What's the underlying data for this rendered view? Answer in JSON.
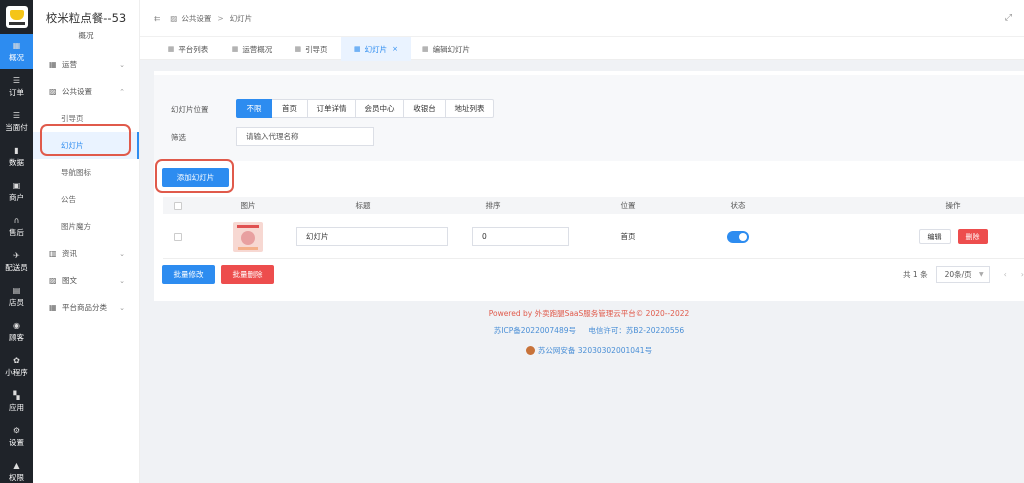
{
  "nav": {
    "items": [
      {
        "label": "概况",
        "icon": "dashboard-icon",
        "glyph": "▦",
        "active": true
      },
      {
        "label": "订单",
        "icon": "list-icon",
        "glyph": "☰"
      },
      {
        "label": "当面付",
        "icon": "pay-icon",
        "glyph": "☰"
      },
      {
        "label": "数据",
        "icon": "chart-icon",
        "glyph": "▮"
      },
      {
        "label": "商户",
        "icon": "store-icon",
        "glyph": "▣"
      },
      {
        "label": "售后",
        "icon": "headset-icon",
        "glyph": "∩"
      },
      {
        "label": "配送员",
        "icon": "rider-icon",
        "glyph": "✈"
      },
      {
        "label": "店员",
        "icon": "staff-icon",
        "glyph": "▤"
      },
      {
        "label": "顾客",
        "icon": "customer-icon",
        "glyph": "◉"
      },
      {
        "label": "小程序",
        "icon": "mini-program-icon",
        "glyph": "✿"
      },
      {
        "label": "应用",
        "icon": "apps-icon",
        "glyph": "▚"
      },
      {
        "label": "设置",
        "icon": "settings-icon",
        "glyph": "⚙"
      },
      {
        "label": "权限",
        "icon": "lock-icon",
        "glyph": "▲"
      }
    ]
  },
  "sidebar": {
    "store_name": "校米粒点餐--53",
    "store_sub": "概况",
    "menu": [
      {
        "label": "运营",
        "icon": "operation-icon",
        "glyph": "▦",
        "chevron": "⌄"
      },
      {
        "label": "公共设置",
        "icon": "image-icon",
        "glyph": "▨",
        "chevron": "⌃"
      }
    ],
    "sub_items": [
      {
        "label": "引导页"
      },
      {
        "label": "幻灯片",
        "active": true
      },
      {
        "label": "导航图标"
      },
      {
        "label": "公告"
      },
      {
        "label": "图片魔方"
      }
    ],
    "menu_after": [
      {
        "label": "资讯",
        "icon": "news-icon",
        "glyph": "▥",
        "chevron": "⌄"
      },
      {
        "label": "图文",
        "icon": "article-icon",
        "glyph": "▨",
        "chevron": "⌄"
      },
      {
        "label": "平台商品分类",
        "icon": "category-icon",
        "glyph": "▦",
        "chevron": "⌄"
      }
    ]
  },
  "topbar": {
    "collapse_glyph": "⇇",
    "crumb_glyph": "▨",
    "crumb_1": "公共设置",
    "crumb_sep": ">",
    "crumb_2": "幻灯片",
    "fullscreen_glyph": "⤢"
  },
  "tabs": [
    {
      "label": "平台列表"
    },
    {
      "label": "运营概况"
    },
    {
      "label": "引导页"
    },
    {
      "label": "幻灯片",
      "active": true,
      "close": "×"
    },
    {
      "label": "编辑幻灯片"
    }
  ],
  "filter": {
    "position_label": "幻灯片位置",
    "positions": [
      "不限",
      "首页",
      "订单详情",
      "会员中心",
      "收银台",
      "地址列表"
    ],
    "active_position": 0,
    "screen_label": "筛选",
    "search_placeholder": "请输入代理名称"
  },
  "actions": {
    "add": "添加幻灯片",
    "batch_edit": "批量修改",
    "batch_delete": "批量删除"
  },
  "table": {
    "columns": [
      "图片",
      "标题",
      "排序",
      "位置",
      "状态",
      "操作"
    ],
    "rows": [
      {
        "title": "幻灯片",
        "sort": "0",
        "position": "首页",
        "enabled": true,
        "edit": "编辑",
        "delete": "删除"
      }
    ]
  },
  "pager": {
    "total": "共 1 条",
    "page_size": "20条/页",
    "prev": "‹",
    "next": "›"
  },
  "footer": {
    "powered": "Powered by 外卖跑腿SaaS服务管理云平台© 2020--2022",
    "icp": "苏ICP备2022007489号",
    "license": "电信许可：苏B2-20220556",
    "police": "苏公网安备 32030302001041号"
  },
  "colors": {
    "primary": "#2d8cf0",
    "danger": "#ed4d4d",
    "nav_bg": "#1f2329",
    "highlight_ring": "#e05a4b"
  }
}
